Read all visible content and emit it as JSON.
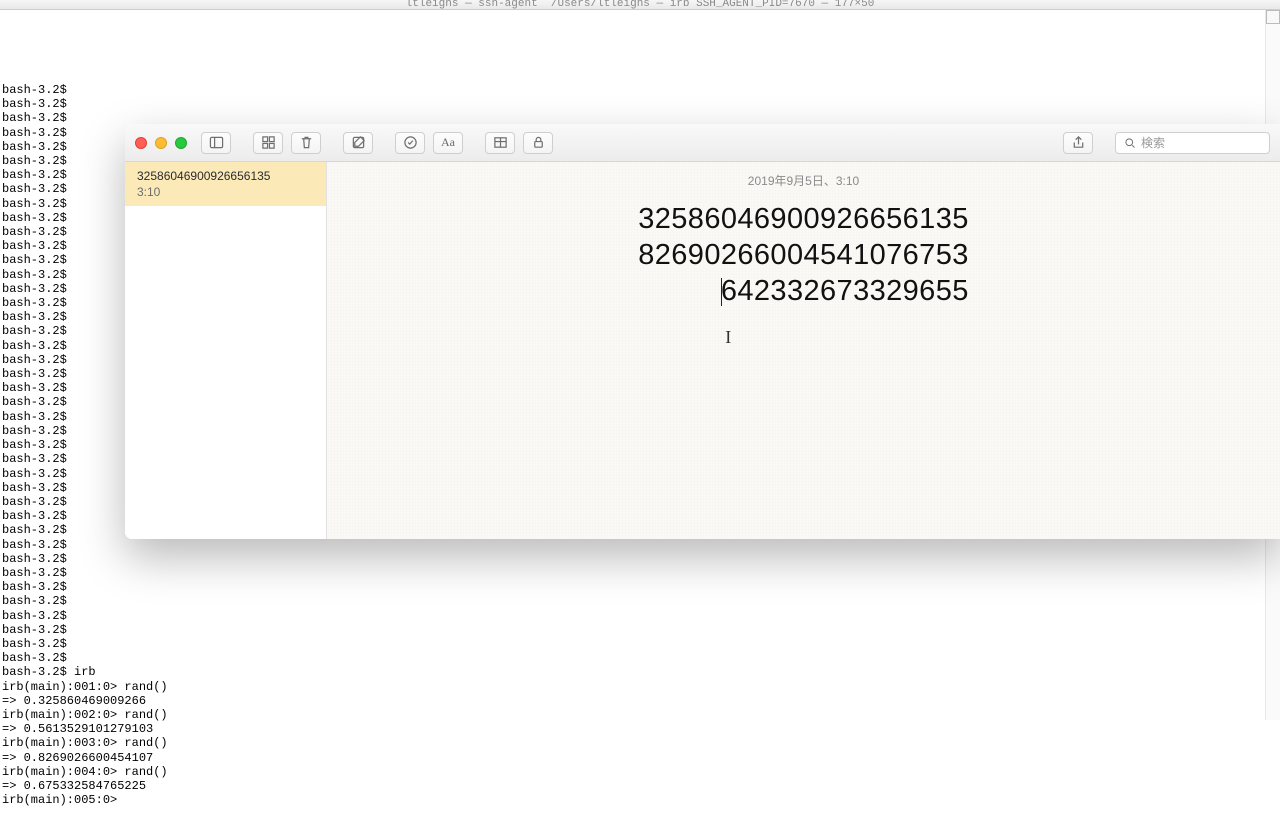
{
  "terminal": {
    "title": "ltleighs — ssh-agent  /Users/ltleighs — irb SSH_AGENT_PID=7670 — 177×50",
    "prompt": "bash-3.2$",
    "prompt_count": 41,
    "irb_cmd": "bash-3.2$ irb",
    "lines": [
      "irb(main):001:0> rand()",
      "=> 0.325860469009266",
      "irb(main):002:0> rand()",
      "=> 0.5613529101279103",
      "irb(main):003:0> rand()",
      "=> 0.8269026600454107",
      "irb(main):004:0> rand()",
      "=> 0.675332584765225",
      "irb(main):005:0> "
    ]
  },
  "notes": {
    "search_placeholder": "検索",
    "sidebar": {
      "items": [
        {
          "title": "32586046900926656135",
          "time": "3:10"
        }
      ]
    },
    "editor": {
      "date": "2019年9月5日、3:10",
      "line1": "32586046900926656135",
      "line2": "82690266004541076753",
      "line3_prefix": "",
      "line3_rest": "642332673329655"
    }
  }
}
